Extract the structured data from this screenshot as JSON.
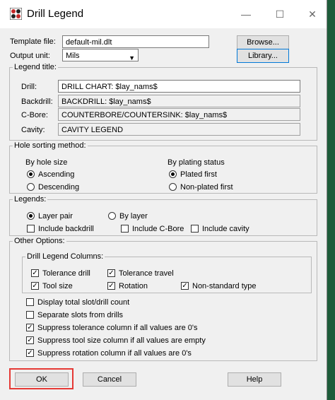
{
  "window": {
    "title": "Drill Legend"
  },
  "template_file": {
    "label": "Template file:",
    "value": "default-mil.dlt",
    "browse": "Browse..."
  },
  "output_unit": {
    "label": "Output unit:",
    "value": "Mils",
    "library": "Library..."
  },
  "legend_title": {
    "group": "Legend title:",
    "drill_label": "Drill:",
    "drill_value": "DRILL CHART: $lay_nams$",
    "backdrill_label": "Backdrill:",
    "backdrill_value": "BACKDRILL: $lay_nams$",
    "cbore_label": "C-Bore:",
    "cbore_value": "COUNTERBORE/COUNTERSINK: $lay_nams$",
    "cavity_label": "Cavity:",
    "cavity_value": "CAVITY LEGEND"
  },
  "hole_sorting": {
    "group": "Hole sorting method:",
    "by_size": "By hole size",
    "ascending": "Ascending",
    "descending": "Descending",
    "by_plating": "By plating status",
    "plated_first": "Plated first",
    "nonplated_first": "Non-plated first"
  },
  "legends": {
    "group": "Legends:",
    "layer_pair": "Layer pair",
    "by_layer": "By layer",
    "include_backdrill": "Include backdrill",
    "include_cbore": "Include C-Bore",
    "include_cavity": "Include cavity"
  },
  "other": {
    "group": "Other Options:",
    "columns_group": "Drill Legend Columns:",
    "tolerance_drill": "Tolerance drill",
    "tolerance_travel": "Tolerance travel",
    "tool_size": "Tool size",
    "rotation": "Rotation",
    "nonstandard": "Non-standard type",
    "display_total": "Display total slot/drill count",
    "separate_slots": "Separate slots from drills",
    "suppress_tolerance": "Suppress tolerance column if all values are 0's",
    "suppress_toolsize": "Suppress tool size column if all values are empty",
    "suppress_rotation": "Suppress rotation column if all values are 0's"
  },
  "buttons": {
    "ok": "OK",
    "cancel": "Cancel",
    "help": "Help"
  }
}
